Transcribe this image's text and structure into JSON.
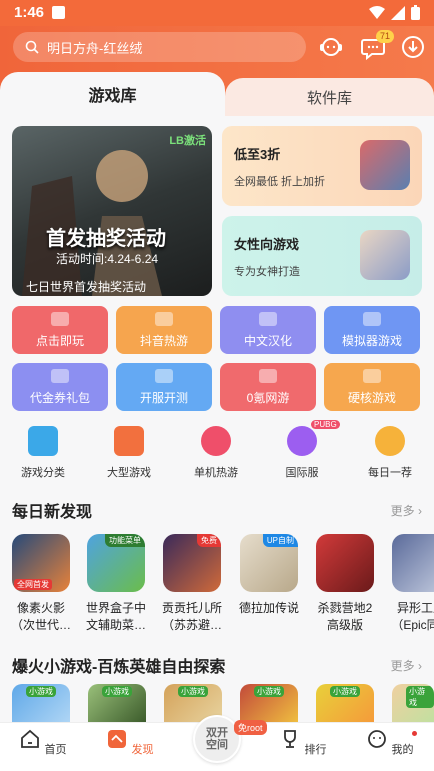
{
  "status_bar": {
    "time": "1:46"
  },
  "header": {
    "search_text": "明日方舟-红丝绒",
    "message_badge": "71"
  },
  "tabs": {
    "active": "游戏库",
    "other": "软件库"
  },
  "banner": {
    "title": "首发抽奖活动",
    "time": "活动时间:4.24-6.24",
    "caption": "七日世界首发抽奖活动",
    "logo": "LB激活"
  },
  "promo_cards": [
    {
      "title": "低至3折",
      "subtitle": "全网最低 折上加折"
    },
    {
      "title": "女性向游戏",
      "subtitle": "专为女神打造"
    }
  ],
  "grid_buttons": [
    {
      "label": "点击即玩",
      "color": "#f0686a"
    },
    {
      "label": "抖音热游",
      "color": "#f6a54e"
    },
    {
      "label": "中文汉化",
      "color": "#8f8ef0"
    },
    {
      "label": "模拟器游戏",
      "color": "#6f96f3"
    },
    {
      "label": "代金券礼包",
      "color": "#8c8ff1"
    },
    {
      "label": "开服开测",
      "color": "#64a9f3"
    },
    {
      "label": "0氪网游",
      "color": "#f06a6d"
    },
    {
      "label": "硬核游戏",
      "color": "#f6a74e"
    }
  ],
  "categories": [
    {
      "label": "游戏分类"
    },
    {
      "label": "大型游戏"
    },
    {
      "label": "单机热游"
    },
    {
      "label": "国际服",
      "badge": "PUBG"
    },
    {
      "label": "每日一荐"
    }
  ],
  "daily_section": {
    "title": "每日新发现",
    "more": "更多",
    "apps": [
      {
        "name_l1": "像素火影",
        "name_l2": "（次世代…",
        "tag": "全网首发"
      },
      {
        "name_l1": "世界盒子中",
        "name_l2": "文辅助菜…",
        "tag": "功能菜单"
      },
      {
        "name_l1": "贡贡托儿所",
        "name_l2": "（苏苏避…",
        "tag": "免费"
      },
      {
        "name_l1": "德拉加传说",
        "name_l2": "",
        "tag": "UP自制"
      },
      {
        "name_l1": "杀戮营地2",
        "name_l2": "高级版",
        "tag": ""
      },
      {
        "name_l1": "异形工厂",
        "name_l2": "（Epic同…",
        "tag": ""
      }
    ]
  },
  "mini_section": {
    "title": "爆火小游戏-百炼英雄自由探索",
    "more": "更多",
    "mini_tag": "小游戏"
  },
  "bottom_nav": {
    "home": "首页",
    "discover": "发现",
    "center": "双开空间",
    "center_tag": "免root",
    "rank": "排行",
    "mine": "我的"
  }
}
